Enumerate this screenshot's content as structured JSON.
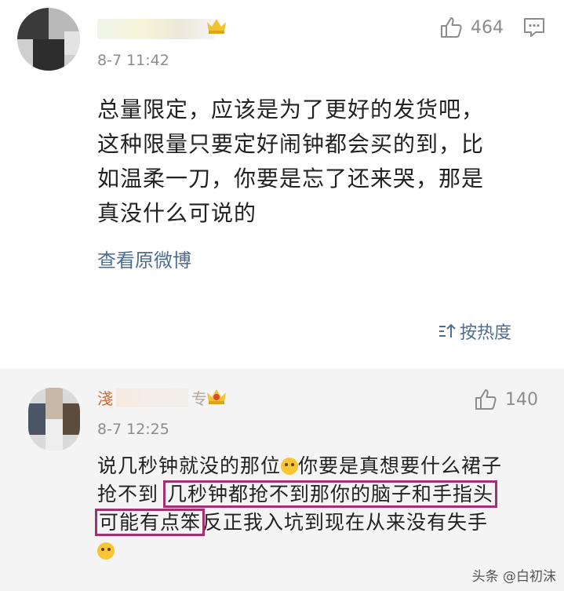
{
  "comment": {
    "time": "8-7 11:42",
    "like_count": "464",
    "lines": [
      "总量限定，应该是为了更好的发货吧，",
      "这种限量只要定好闹钟都会买的到，比",
      "如温柔一刀，你要是忘了还来哭，那是",
      "真没什么可说的"
    ],
    "view_original": "查看原微博",
    "sort_label": "按热度"
  },
  "reply": {
    "name_first_char": "淺",
    "name_last_char": "专",
    "time": "8-7 12:25",
    "like_count": "140",
    "line1_a": "说几秒钟就没的那位",
    "line1_b": "你要是真想要什么裙子",
    "line2_a": "抢不到",
    "line2_hl": "几秒钟都抢不到那你的脑子和手指头",
    "line3_hl": "可能有点笨",
    "line3_b": "反正我入坑到现在从来没有失手"
  },
  "watermark": "头条 @白初沫",
  "colors": {
    "link": "#4d6d92",
    "highlight_box": "#a3316f",
    "meta_gray": "#8c8c8c",
    "reply_bg": "#f4f4f4"
  },
  "icons": [
    "thumb-up-icon",
    "comment-icon",
    "sort-icon",
    "crown-badge-icon",
    "grin-emoji-icon"
  ]
}
